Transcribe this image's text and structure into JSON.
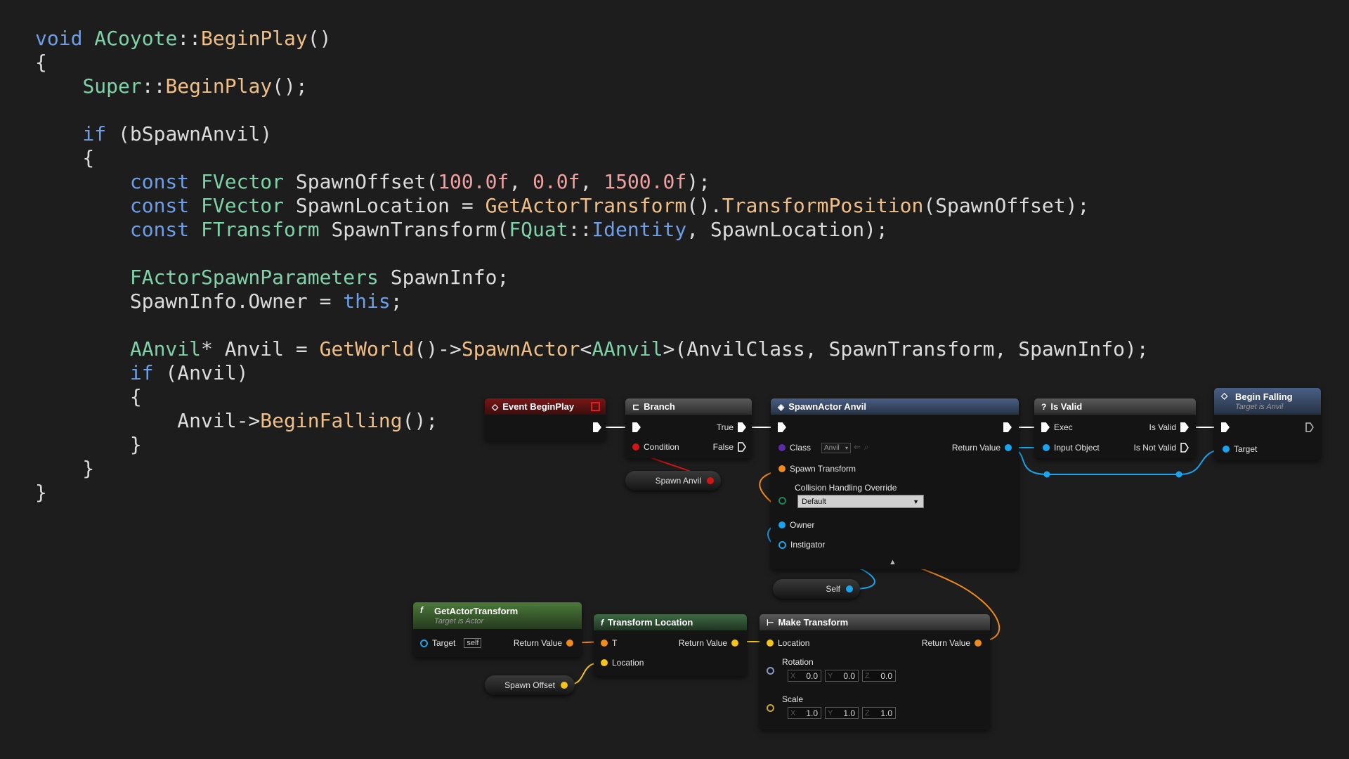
{
  "code_lines": [
    [
      {
        "c": "kw",
        "t": "void"
      },
      {
        "c": "tx",
        "t": " "
      },
      {
        "c": "ty",
        "t": "ACoyote"
      },
      {
        "c": "tx",
        "t": "::"
      },
      {
        "c": "fn",
        "t": "BeginPlay"
      },
      {
        "c": "tx",
        "t": "()"
      }
    ],
    [
      {
        "c": "tx",
        "t": "{"
      }
    ],
    [
      {
        "c": "tx",
        "t": "    "
      },
      {
        "c": "ty",
        "t": "Super"
      },
      {
        "c": "tx",
        "t": "::"
      },
      {
        "c": "fn",
        "t": "BeginPlay"
      },
      {
        "c": "tx",
        "t": "();"
      }
    ],
    [],
    [
      {
        "c": "tx",
        "t": "    "
      },
      {
        "c": "kw",
        "t": "if"
      },
      {
        "c": "tx",
        "t": " (bSpawnAnvil)"
      }
    ],
    [
      {
        "c": "tx",
        "t": "    {"
      }
    ],
    [
      {
        "c": "tx",
        "t": "        "
      },
      {
        "c": "kw",
        "t": "const"
      },
      {
        "c": "tx",
        "t": " "
      },
      {
        "c": "ty",
        "t": "FVector"
      },
      {
        "c": "tx",
        "t": " SpawnOffset("
      },
      {
        "c": "nm",
        "t": "100.0f"
      },
      {
        "c": "tx",
        "t": ", "
      },
      {
        "c": "nm",
        "t": "0.0f"
      },
      {
        "c": "tx",
        "t": ", "
      },
      {
        "c": "nm",
        "t": "1500.0f"
      },
      {
        "c": "tx",
        "t": ");"
      }
    ],
    [
      {
        "c": "tx",
        "t": "        "
      },
      {
        "c": "kw",
        "t": "const"
      },
      {
        "c": "tx",
        "t": " "
      },
      {
        "c": "ty",
        "t": "FVector"
      },
      {
        "c": "tx",
        "t": " SpawnLocation = "
      },
      {
        "c": "fn",
        "t": "GetActorTransform"
      },
      {
        "c": "tx",
        "t": "()."
      },
      {
        "c": "fn",
        "t": "TransformPosition"
      },
      {
        "c": "tx",
        "t": "(SpawnOffset);"
      }
    ],
    [
      {
        "c": "tx",
        "t": "        "
      },
      {
        "c": "kw",
        "t": "const"
      },
      {
        "c": "tx",
        "t": " "
      },
      {
        "c": "ty",
        "t": "FTransform"
      },
      {
        "c": "tx",
        "t": " SpawnTransform("
      },
      {
        "c": "ty",
        "t": "FQuat"
      },
      {
        "c": "tx",
        "t": "::"
      },
      {
        "c": "kw",
        "t": "Identity"
      },
      {
        "c": "tx",
        "t": ", SpawnLocation);"
      }
    ],
    [],
    [
      {
        "c": "tx",
        "t": "        "
      },
      {
        "c": "ty",
        "t": "FActorSpawnParameters"
      },
      {
        "c": "tx",
        "t": " SpawnInfo;"
      }
    ],
    [
      {
        "c": "tx",
        "t": "        SpawnInfo.Owner = "
      },
      {
        "c": "kw",
        "t": "this"
      },
      {
        "c": "tx",
        "t": ";"
      }
    ],
    [],
    [
      {
        "c": "tx",
        "t": "        "
      },
      {
        "c": "ty",
        "t": "AAnvil"
      },
      {
        "c": "tx",
        "t": "* Anvil = "
      },
      {
        "c": "fn",
        "t": "GetWorld"
      },
      {
        "c": "tx",
        "t": "()->"
      },
      {
        "c": "fn",
        "t": "SpawnActor"
      },
      {
        "c": "tx",
        "t": "<"
      },
      {
        "c": "ty",
        "t": "AAnvil"
      },
      {
        "c": "tx",
        "t": ">(AnvilClass, SpawnTransform, SpawnInfo);"
      }
    ],
    [
      {
        "c": "tx",
        "t": "        "
      },
      {
        "c": "kw",
        "t": "if"
      },
      {
        "c": "tx",
        "t": " (Anvil)"
      }
    ],
    [
      {
        "c": "tx",
        "t": "        {"
      }
    ],
    [
      {
        "c": "tx",
        "t": "            Anvil->"
      },
      {
        "c": "fn",
        "t": "BeginFalling"
      },
      {
        "c": "tx",
        "t": "();"
      }
    ],
    [
      {
        "c": "tx",
        "t": "        }"
      }
    ],
    [
      {
        "c": "tx",
        "t": "    }"
      }
    ],
    [
      {
        "c": "tx",
        "t": "}"
      }
    ]
  ],
  "colors": {
    "keyword": "#6d9ee8",
    "type": "#7fd3a8",
    "function": "#efbf87",
    "number": "#f0a0a0",
    "exec_wire": "#ffffff",
    "object_wire": "#19a4f0",
    "transform_wire": "#f08a1a",
    "vector_wire": "#f4c419",
    "bool_wire": "#d41515"
  },
  "nodes": {
    "event_beginplay": {
      "title": "Event BeginPlay",
      "icon": "event-diamond-icon"
    },
    "branch": {
      "title": "Branch",
      "icon": "branch-icon",
      "true_label": "True",
      "false_label": "False",
      "condition_label": "Condition"
    },
    "spawn_actor": {
      "title": "SpawnActor Anvil",
      "icon": "spawn-icon",
      "class_label": "Class",
      "class_value": "Anvil",
      "spawn_transform_label": "Spawn Transform",
      "collision_label": "Collision Handling Override",
      "collision_value": "Default",
      "owner_label": "Owner",
      "instigator_label": "Instigator",
      "return_label": "Return Value"
    },
    "is_valid": {
      "title": "Is Valid",
      "icon": "question-icon",
      "exec_label": "Exec",
      "input_label": "Input Object",
      "valid_label": "Is Valid",
      "not_valid_label": "Is Not Valid"
    },
    "begin_falling": {
      "title": "Begin Falling",
      "subtitle": "Target is Anvil",
      "icon": "function-diamond-icon",
      "target_label": "Target"
    },
    "get_actor_transform": {
      "title": "GetActorTransform",
      "subtitle": "Target is Actor",
      "icon": "function-f-icon",
      "target_label": "Target",
      "target_value": "self",
      "return_label": "Return Value"
    },
    "transform_location": {
      "title": "Transform Location",
      "icon": "function-f-icon",
      "t_label": "T",
      "location_label": "Location",
      "return_label": "Return Value"
    },
    "make_transform": {
      "title": "Make Transform",
      "icon": "make-struct-icon",
      "location_label": "Location",
      "rotation_label": "Rotation",
      "scale_label": "Scale",
      "return_label": "Return Value",
      "axis_x": "X",
      "axis_y": "Y",
      "axis_z": "Z",
      "rotation": [
        "0.0",
        "0.0",
        "0.0"
      ],
      "scale": [
        "1.0",
        "1.0",
        "1.0"
      ]
    }
  },
  "variables": {
    "spawn_anvil": "Spawn Anvil",
    "self": "Self",
    "spawn_offset": "Spawn Offset"
  }
}
